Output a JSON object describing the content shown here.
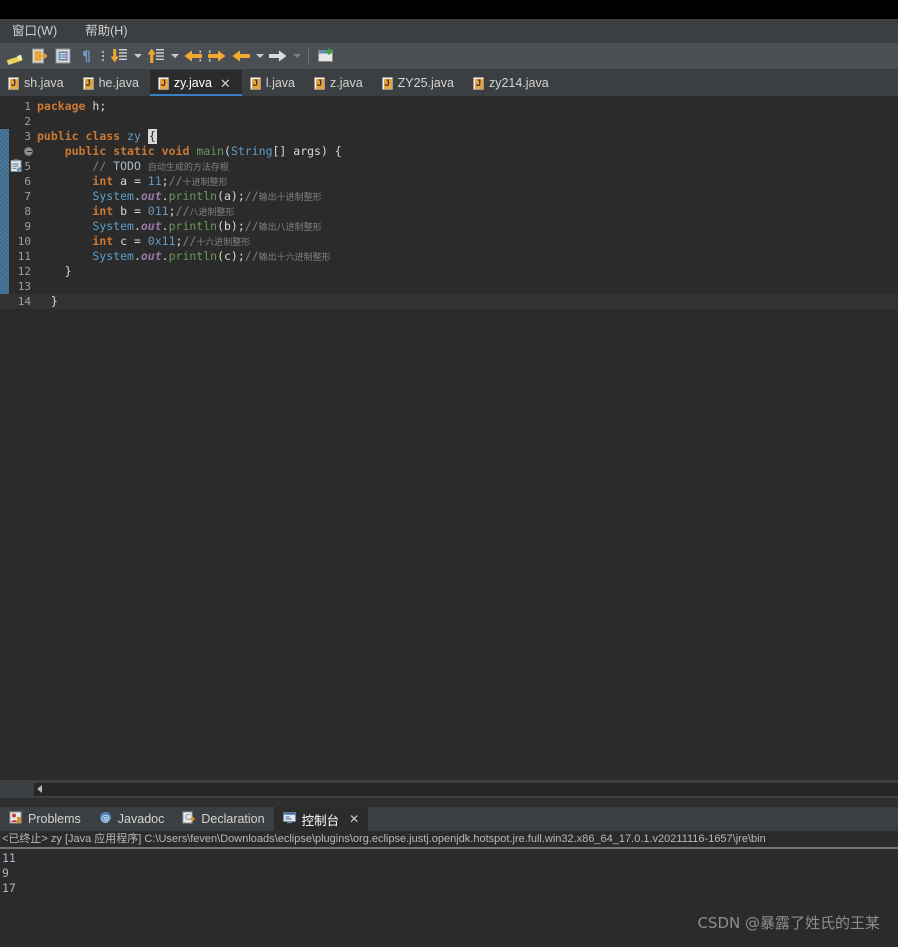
{
  "menu": {
    "items": [
      {
        "label": "窗口(W)",
        "name": "menu-window"
      },
      {
        "label": "帮助(H)",
        "name": "menu-help"
      }
    ]
  },
  "toolbar": {
    "items": [
      {
        "name": "toggle-mark-occurrences-icon",
        "kind": "pencil"
      },
      {
        "name": "new-java-class-icon",
        "kind": "newclass"
      },
      {
        "name": "open-type-icon",
        "kind": "opentype"
      },
      {
        "name": "show-whitespace-icon",
        "kind": "pilcrow"
      },
      {
        "name": "toolbar-overflow-dots",
        "kind": "dots"
      },
      {
        "name": "next-annotation-icon",
        "kind": "down-yellow"
      },
      {
        "name": "next-annotation-dropdown",
        "kind": "caret"
      },
      {
        "name": "previous-annotation-icon",
        "kind": "up-yellow"
      },
      {
        "name": "previous-annotation-dropdown",
        "kind": "caret"
      },
      {
        "name": "last-edit-location-icon",
        "kind": "left-yellow-dotted"
      },
      {
        "name": "next-edit-location-icon",
        "kind": "right-yellow-dotted"
      },
      {
        "name": "back-icon",
        "kind": "left-yellow"
      },
      {
        "name": "back-dropdown",
        "kind": "caret"
      },
      {
        "name": "forward-icon",
        "kind": "right-white"
      },
      {
        "name": "forward-dropdown",
        "kind": "caret-dim"
      },
      {
        "name": "toolbar-separator",
        "kind": "sep"
      },
      {
        "name": "new-window-icon",
        "kind": "window"
      }
    ]
  },
  "editor_tabs": {
    "items": [
      {
        "label": "sh.java",
        "active": false
      },
      {
        "label": "he.java",
        "active": false
      },
      {
        "label": "zy.java",
        "active": true
      },
      {
        "label": "l.java",
        "active": false
      },
      {
        "label": "z.java",
        "active": false
      },
      {
        "label": "ZY25.java",
        "active": false
      },
      {
        "label": "zy214.java",
        "active": false
      }
    ],
    "close_glyph": "✕"
  },
  "code": {
    "file": "zy.java",
    "current_line": 14,
    "fold_line": 4,
    "change_bar_from_line": 3,
    "change_bar_to_line": 14,
    "marker_line": 5,
    "lines": [
      {
        "n": 1,
        "tokens": [
          {
            "t": "kw",
            "v": "package"
          },
          {
            "t": "pln",
            "v": " h;"
          }
        ]
      },
      {
        "n": 2,
        "tokens": []
      },
      {
        "n": 3,
        "tokens": [
          {
            "t": "kw",
            "v": "public"
          },
          {
            "t": "pln",
            "v": " "
          },
          {
            "t": "kw",
            "v": "class"
          },
          {
            "t": "pln",
            "v": " "
          },
          {
            "t": "cls",
            "v": "zy"
          },
          {
            "t": "pln",
            "v": " "
          },
          {
            "t": "cursor",
            "v": "{"
          }
        ]
      },
      {
        "n": 4,
        "tokens": [
          {
            "t": "pln",
            "v": "    "
          },
          {
            "t": "kw",
            "v": "public"
          },
          {
            "t": "pln",
            "v": " "
          },
          {
            "t": "kw",
            "v": "static"
          },
          {
            "t": "pln",
            "v": " "
          },
          {
            "t": "kw",
            "v": "void"
          },
          {
            "t": "pln",
            "v": " "
          },
          {
            "t": "mth",
            "v": "main"
          },
          {
            "t": "pln",
            "v": "("
          },
          {
            "t": "cls",
            "v": "String"
          },
          {
            "t": "pln",
            "v": "[] args) {"
          }
        ]
      },
      {
        "n": 5,
        "tokens": [
          {
            "t": "pln",
            "v": "        "
          },
          {
            "t": "cmt",
            "v": "// "
          },
          {
            "t": "todo",
            "v": "TODO"
          },
          {
            "t": "pln",
            "v": " "
          },
          {
            "t": "cmtcn",
            "v": "自动生成的方法存根"
          }
        ]
      },
      {
        "n": 6,
        "tokens": [
          {
            "t": "pln",
            "v": "        "
          },
          {
            "t": "kw",
            "v": "int"
          },
          {
            "t": "pln",
            "v": " a = "
          },
          {
            "t": "num",
            "v": "11"
          },
          {
            "t": "pln",
            "v": ";"
          },
          {
            "t": "cmt",
            "v": "//"
          },
          {
            "t": "cmtcn",
            "v": "十进制整形"
          }
        ]
      },
      {
        "n": 7,
        "tokens": [
          {
            "t": "pln",
            "v": "        "
          },
          {
            "t": "cls",
            "v": "System"
          },
          {
            "t": "pln",
            "v": "."
          },
          {
            "t": "fld",
            "v": "out"
          },
          {
            "t": "pln",
            "v": "."
          },
          {
            "t": "mth",
            "v": "println"
          },
          {
            "t": "pln",
            "v": "(a);"
          },
          {
            "t": "cmt",
            "v": "//"
          },
          {
            "t": "cmtcn",
            "v": "输出十进制整形"
          }
        ]
      },
      {
        "n": 8,
        "tokens": [
          {
            "t": "pln",
            "v": "        "
          },
          {
            "t": "kw",
            "v": "int"
          },
          {
            "t": "pln",
            "v": " b = "
          },
          {
            "t": "num",
            "v": "011"
          },
          {
            "t": "pln",
            "v": ";"
          },
          {
            "t": "cmt",
            "v": "//"
          },
          {
            "t": "cmtcn",
            "v": "八进制整形"
          }
        ]
      },
      {
        "n": 9,
        "tokens": [
          {
            "t": "pln",
            "v": "        "
          },
          {
            "t": "cls",
            "v": "System"
          },
          {
            "t": "pln",
            "v": "."
          },
          {
            "t": "fld",
            "v": "out"
          },
          {
            "t": "pln",
            "v": "."
          },
          {
            "t": "mth",
            "v": "println"
          },
          {
            "t": "pln",
            "v": "(b);"
          },
          {
            "t": "cmt",
            "v": "//"
          },
          {
            "t": "cmtcn",
            "v": "输出八进制整形"
          }
        ]
      },
      {
        "n": 10,
        "tokens": [
          {
            "t": "pln",
            "v": "        "
          },
          {
            "t": "kw",
            "v": "int"
          },
          {
            "t": "pln",
            "v": " c = "
          },
          {
            "t": "num",
            "v": "0x11"
          },
          {
            "t": "pln",
            "v": ";"
          },
          {
            "t": "cmt",
            "v": "//"
          },
          {
            "t": "cmtcn",
            "v": "十六进制整形"
          }
        ]
      },
      {
        "n": 11,
        "tokens": [
          {
            "t": "pln",
            "v": "        "
          },
          {
            "t": "cls",
            "v": "System"
          },
          {
            "t": "pln",
            "v": "."
          },
          {
            "t": "fld",
            "v": "out"
          },
          {
            "t": "pln",
            "v": "."
          },
          {
            "t": "mth",
            "v": "println"
          },
          {
            "t": "pln",
            "v": "(c);"
          },
          {
            "t": "cmt",
            "v": "//"
          },
          {
            "t": "cmtcn",
            "v": "输出十六进制整形"
          }
        ]
      },
      {
        "n": 12,
        "tokens": [
          {
            "t": "pln",
            "v": "    }"
          }
        ]
      },
      {
        "n": 13,
        "tokens": []
      },
      {
        "n": 14,
        "tokens": [
          {
            "t": "pln",
            "v": "  }"
          }
        ]
      }
    ]
  },
  "view_tabs": {
    "items": [
      {
        "label": "Problems",
        "icon": "problems-icon",
        "active": false
      },
      {
        "label": "Javadoc",
        "icon": "javadoc-icon",
        "active": false
      },
      {
        "label": "Declaration",
        "icon": "declaration-icon",
        "active": false
      },
      {
        "label": "控制台",
        "icon": "console-icon",
        "active": true
      }
    ],
    "close_glyph": "✕"
  },
  "console": {
    "header": "<已终止> zy [Java 应用程序] C:\\Users\\feven\\Downloads\\eclipse\\plugins\\org.eclipse.justj.openjdk.hotspot.jre.full.win32.x86_64_17.0.1.v20211116-1657\\jre\\bin",
    "output_lines": [
      "11",
      "9",
      "17"
    ]
  },
  "watermark": {
    "text": "CSDN @暴露了姓氏的王某"
  },
  "colors": {
    "editor_bg": "#2b2b2b",
    "chrome_bg": "#3c3f41",
    "toolbar_bg": "#4a4f54",
    "accent_blue": "#3a7dc9",
    "keyword": "#cc7832",
    "class": "#5e9ecb",
    "number": "#6897bb",
    "comment": "#808080",
    "method": "#6a9955"
  }
}
